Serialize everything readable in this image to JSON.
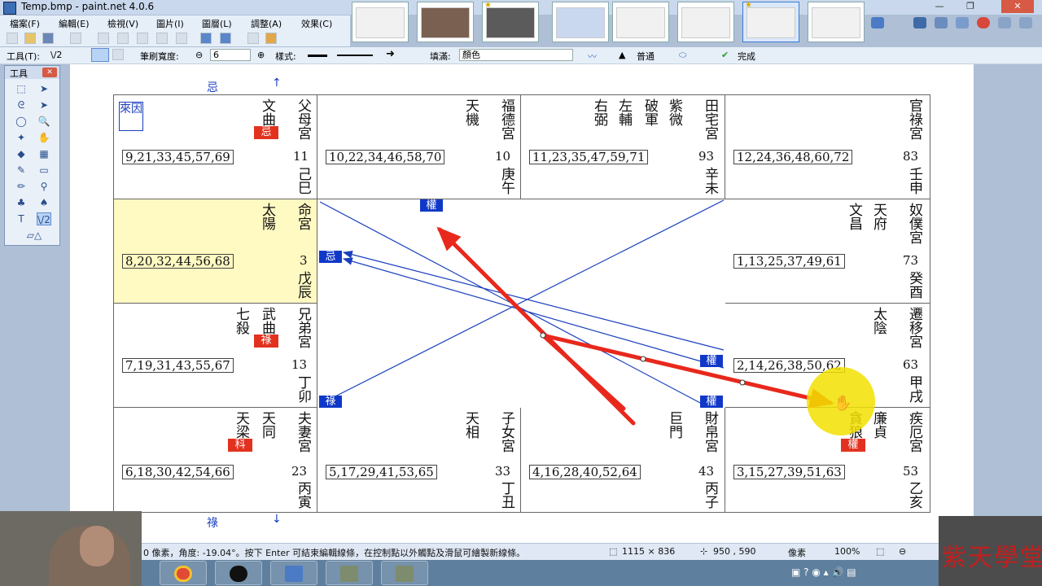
{
  "window": {
    "title": "Temp.bmp - paint.net 4.0.6"
  },
  "menu": [
    "檔案(F)",
    "編輯(E)",
    "檢視(V)",
    "圖片(I)",
    "圖層(L)",
    "調整(A)",
    "效果(C)"
  ],
  "toolbar": {
    "tool_label": "工具(T):",
    "tool_value": "\\/2",
    "brush_width_label": "筆刷寬度:",
    "brush_width_value": "6",
    "style_label": "樣式:",
    "fill_label": "填滿:",
    "fill_value": "顏色",
    "mode_value": "普通",
    "finish_label": "完成"
  },
  "tools_window": {
    "title": "工具"
  },
  "chart": {
    "top_label": "忌",
    "bottom_label": "祿",
    "laiyin": "來因",
    "cells": [
      {
        "id": "si",
        "palace": "父母宮",
        "stars": [
          "文曲"
        ],
        "badge": "忌",
        "ages": "9,21,33,45,57,69",
        "num": "11",
        "gz": "己巳",
        "laiyin": true
      },
      {
        "id": "wu",
        "palace": "福德宮",
        "stars": [
          "天機"
        ],
        "ages": "10,22,34,46,58,70",
        "num": "10",
        "gz": "庚午"
      },
      {
        "id": "wei",
        "palace": "田宅宮",
        "stars": [
          "紫微",
          "破軍",
          "左輔",
          "右弼"
        ],
        "ages": "11,23,35,47,59,71",
        "num": "93",
        "gz": "辛未"
      },
      {
        "id": "shen",
        "palace": "官祿宮",
        "stars": [],
        "ages": "12,24,36,48,60,72",
        "num": "83",
        "gz": "壬申"
      },
      {
        "id": "chen",
        "palace": "命宮",
        "stars": [
          "太陽"
        ],
        "ages": "8,20,32,44,56,68",
        "num": "3",
        "gz": "戊辰",
        "highlight": true
      },
      {
        "id": "you",
        "palace": "奴僕宮",
        "stars": [
          "天府",
          "文昌"
        ],
        "ages": "1,13,25,37,49,61",
        "num": "73",
        "gz": "癸酉"
      },
      {
        "id": "mao",
        "palace": "兄弟宮",
        "stars": [
          "武曲",
          "七殺"
        ],
        "badge": "祿",
        "ages": "7,19,31,43,55,67",
        "num": "13",
        "gz": "丁卯"
      },
      {
        "id": "xu",
        "palace": "遷移宮",
        "stars": [
          "太陰"
        ],
        "ages": "2,14,26,38,50,62",
        "num": "63",
        "gz": "甲戌"
      },
      {
        "id": "yin",
        "palace": "夫妻宮",
        "stars": [
          "天同",
          "天梁"
        ],
        "badge": "科",
        "ages": "6,18,30,42,54,66",
        "num": "23",
        "gz": "丙寅"
      },
      {
        "id": "chou",
        "palace": "子女宮",
        "stars": [
          "天相"
        ],
        "ages": "5,17,29,41,53,65",
        "num": "33",
        "gz": "丁丑"
      },
      {
        "id": "zi",
        "palace": "財帛宮",
        "stars": [
          "巨門"
        ],
        "ages": "4,16,28,40,52,64",
        "num": "43",
        "gz": "丙子"
      },
      {
        "id": "hai",
        "palace": "疾厄宮",
        "stars": [
          "廉貞",
          "貪狼"
        ],
        "badge": "權",
        "ages": "3,15,27,39,51,63",
        "num": "53",
        "gz": "乙亥"
      }
    ],
    "center_badges": [
      "權",
      "忌",
      "權",
      "權",
      "祿"
    ]
  },
  "status": {
    "hint": "0 像素，角度: -19.04°。按下 Enter 可結束編輯線條，在控制點以外觸點及滑鼠可繪製新線條。",
    "image_size": "1115 × 836",
    "cursor": "950 , 590",
    "unit": "像素",
    "zoom": "100%"
  },
  "logo": {
    "text": "紫天學堂"
  },
  "colors": {
    "accent_blue": "#1038c8",
    "badge_red": "#e2321f",
    "highlight": "#fff9c2",
    "arrow_red": "#e8281c"
  }
}
